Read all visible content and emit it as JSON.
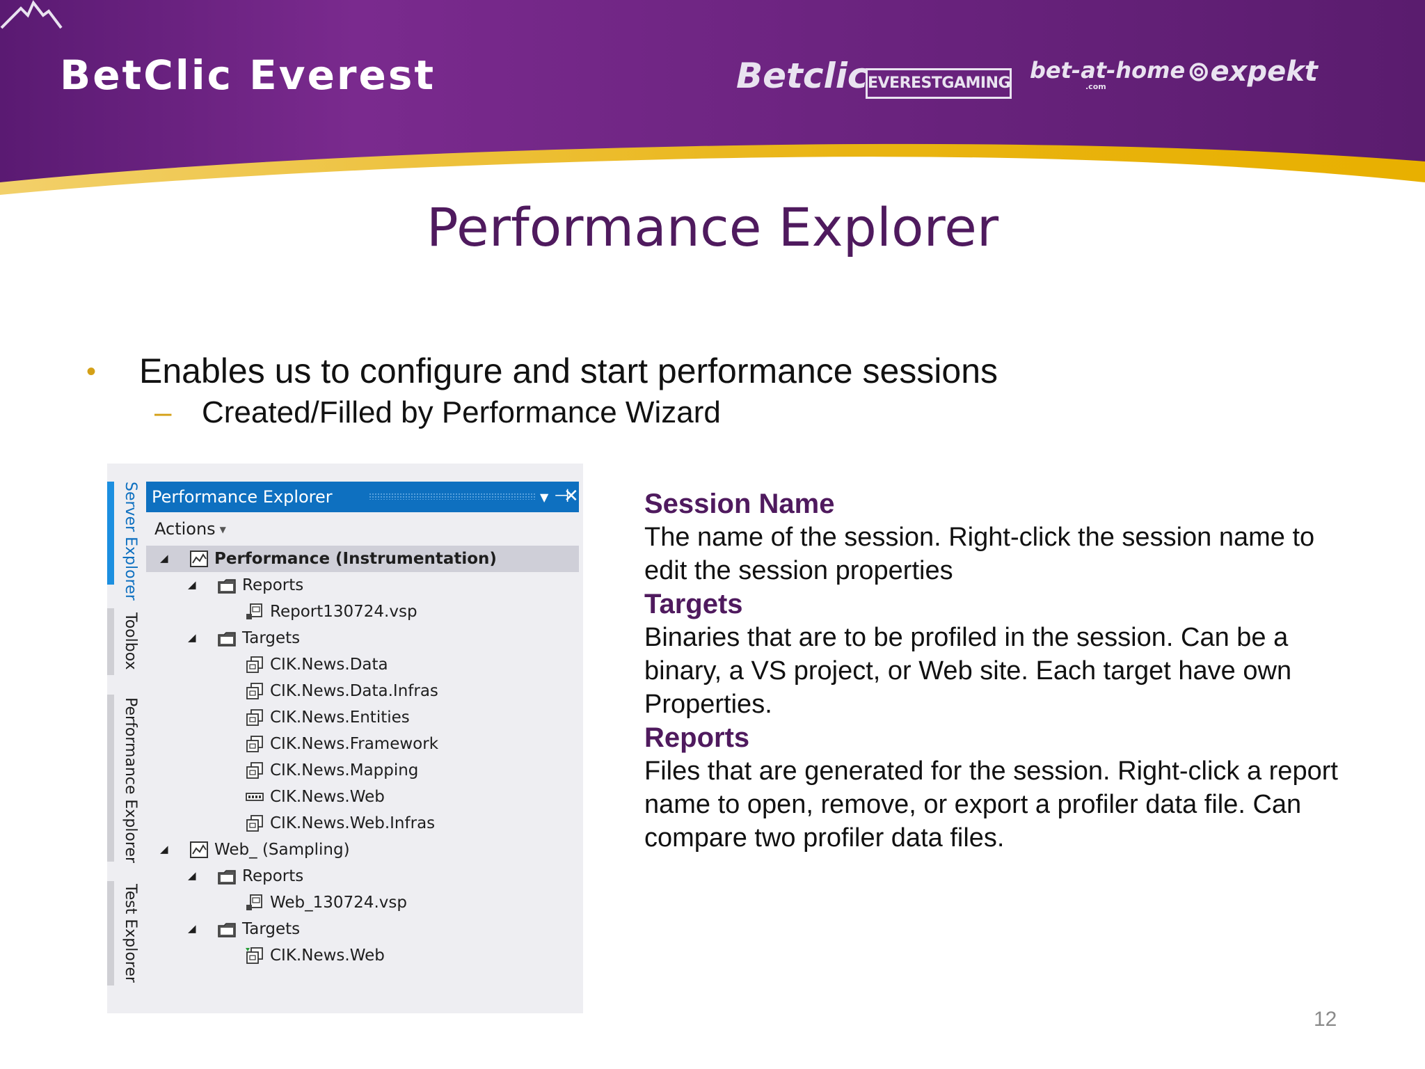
{
  "header": {
    "company": "BetClic Everest",
    "brands": {
      "betclic": "Betclic",
      "everest": "EVERESTGAMING",
      "betathome": "bet-at-home",
      "betathome_sub": ".com",
      "expekt": "expekt"
    },
    "colors": {
      "purple": "#6a2080",
      "gold": "#e8b400"
    }
  },
  "slide": {
    "title": "Performance Explorer",
    "bullet": "Enables us to configure and start performance sessions",
    "subbullet": "Created/Filled by Performance Wizard",
    "page_number": "12"
  },
  "side_tabs": [
    "Server Explorer",
    "Toolbox",
    "Performance Explorer",
    "Test Explorer"
  ],
  "panel": {
    "title": "Performance Explorer",
    "actions_label": "Actions",
    "buttons": {
      "dropdown": "▼",
      "pin": "⊣",
      "close": "✕"
    },
    "tree": [
      {
        "label": "Performance (Instrumentation)",
        "icon": "performance-session-icon",
        "expander": "◢"
      },
      {
        "label": "Reports",
        "icon": "folder-icon",
        "expander": "◢"
      },
      {
        "label": "Report130724.vsp",
        "icon": "report-file-icon"
      },
      {
        "label": "Targets",
        "icon": "folder-icon",
        "expander": "◢"
      },
      {
        "label": "CIK.News.Data",
        "icon": "target-project-icon"
      },
      {
        "label": "CIK.News.Data.Infras",
        "icon": "target-project-icon"
      },
      {
        "label": "CIK.News.Entities",
        "icon": "target-project-icon"
      },
      {
        "label": "CIK.News.Framework",
        "icon": "target-project-icon"
      },
      {
        "label": "CIK.News.Mapping",
        "icon": "target-project-icon"
      },
      {
        "label": "CIK.News.Web",
        "icon": "binary-target-icon"
      },
      {
        "label": "CIK.News.Web.Infras",
        "icon": "target-project-icon"
      },
      {
        "label": "Web_ (Sampling)",
        "icon": "performance-session-icon",
        "expander": "◢"
      },
      {
        "label": "Reports",
        "icon": "folder-icon",
        "expander": "◢"
      },
      {
        "label": "Web_130724.vsp",
        "icon": "report-file-icon"
      },
      {
        "label": "Targets",
        "icon": "folder-icon",
        "expander": "◢"
      },
      {
        "label": "CIK.News.Web",
        "icon": "web-target-icon"
      }
    ]
  },
  "descriptions": [
    {
      "heading": "Session Name",
      "text": "The name of the session. Right-click the session name to edit the session properties"
    },
    {
      "heading": "Targets",
      "text": "Binaries that are to be profiled in the session. Can be a binary, a VS project, or Web site. Each target have own Properties."
    },
    {
      "heading": "Reports",
      "text": "Files that are generated for the session. Right-click a report name to open, remove, or export a profiler data file. Can compare two profiler data files."
    }
  ]
}
